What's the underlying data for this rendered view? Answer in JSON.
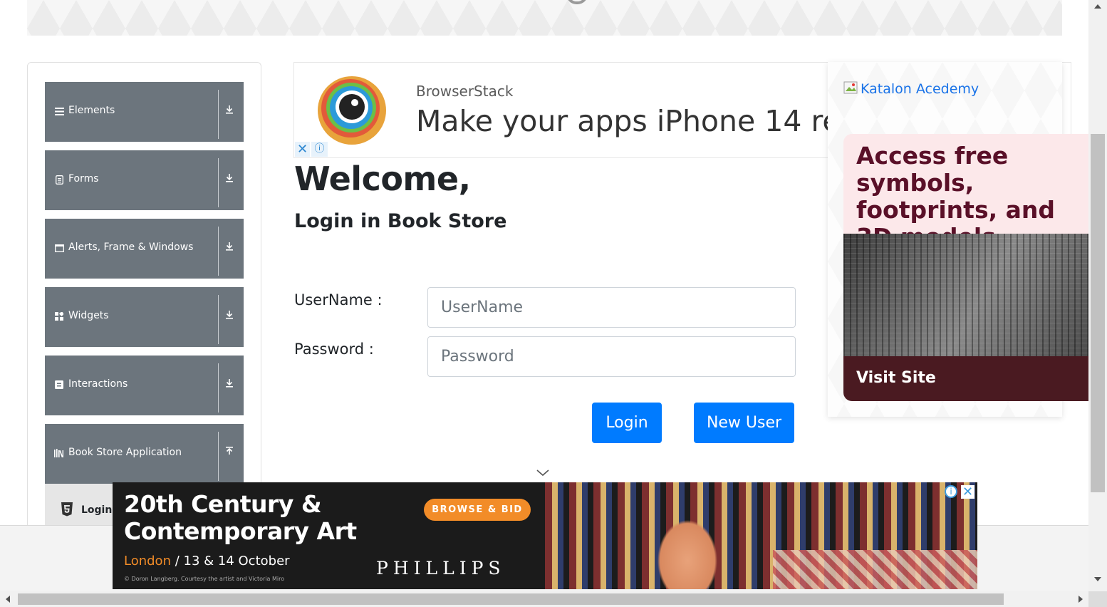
{
  "sidebar": {
    "groups": [
      {
        "label": "Elements",
        "icon": "hamburger-icon",
        "state": "collapsed"
      },
      {
        "label": "Forms",
        "icon": "form-icon",
        "state": "collapsed"
      },
      {
        "label": "Alerts, Frame & Windows",
        "icon": "window-icon",
        "state": "collapsed"
      },
      {
        "label": "Widgets",
        "icon": "widgets-icon",
        "state": "collapsed"
      },
      {
        "label": "Interactions",
        "icon": "interactions-icon",
        "state": "collapsed"
      },
      {
        "label": "Book Store Application",
        "icon": "library-icon",
        "state": "expanded"
      }
    ],
    "active_item": {
      "label": "Login",
      "icon": "html5-icon"
    }
  },
  "top_ad": {
    "brand": "BrowserStack",
    "headline": "Make your apps iPhone 14 re",
    "close_icon": "close-icon",
    "info_icon": "info-icon"
  },
  "main": {
    "welcome": "Welcome,",
    "subtitle": "Login in Book Store",
    "username_label": "UserName :",
    "username_placeholder": "UserName",
    "username_value": "",
    "password_label": "Password :",
    "password_placeholder": "Password",
    "password_value": "",
    "login_button": "Login",
    "new_user_button": "New User"
  },
  "right_ad": {
    "image_alt": "Katalon Acedemy",
    "promo_text": "Access free symbols, footprints, and 3D models.",
    "cta": "Visit Site"
  },
  "bottom_ad": {
    "title": "20th Century & Contemporary Art",
    "city": "London",
    "dates": " / 13 & 14 October",
    "credit": "© Doron Langberg. Courtesy the artist and Victoria Miro",
    "bid_button": "BROWSE & BID",
    "brand": "PHILLIPS"
  },
  "colors": {
    "sidebar_group_bg": "#6c757d",
    "primary_button": "#007bff",
    "promo_bg": "#fce8ea",
    "promo_text": "#5a1028",
    "bid_orange": "#f28c28"
  }
}
